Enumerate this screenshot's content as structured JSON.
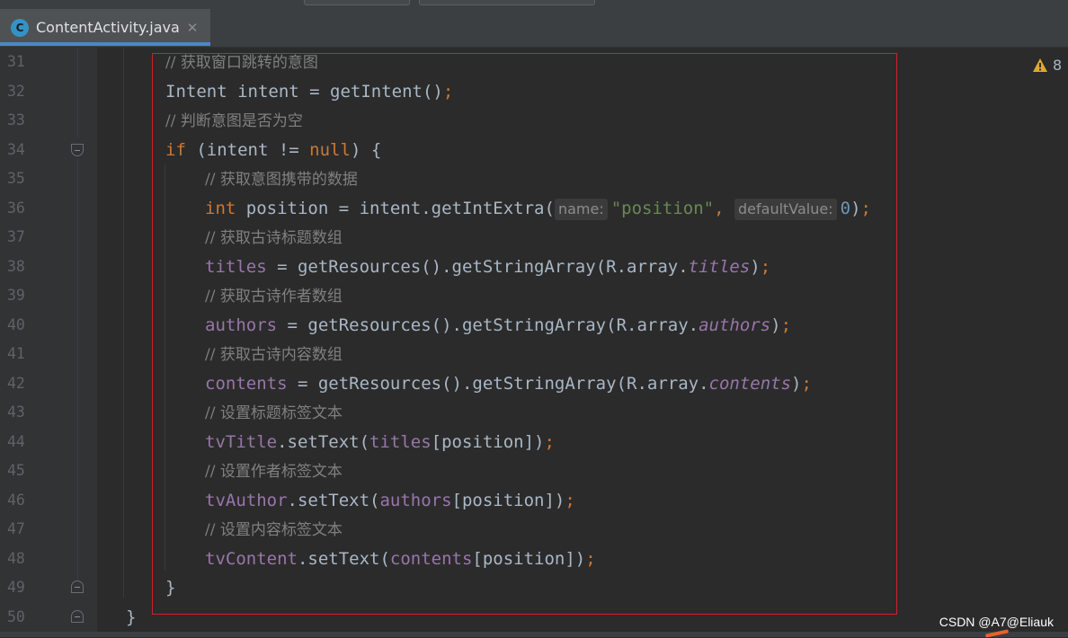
{
  "tab": {
    "icon_letter": "C",
    "title": "ContentActivity.java",
    "close_glyph": "✕"
  },
  "inspections": {
    "warning_count": "8"
  },
  "line_numbers": [
    "31",
    "32",
    "33",
    "34",
    "35",
    "36",
    "37",
    "38",
    "39",
    "40",
    "41",
    "42",
    "43",
    "44",
    "45",
    "46",
    "47",
    "48",
    "49",
    "50"
  ],
  "code": {
    "l31": {
      "comment": "// 获取窗口跳转的意图"
    },
    "l32": {
      "type": "Intent",
      "rest": " intent = getIntent()",
      "semi": ";"
    },
    "l33": {
      "comment": "// 判断意图是否为空"
    },
    "l34": {
      "kw": "if",
      "a": " (intent != ",
      "null": "null",
      "b": ") {"
    },
    "l35": {
      "comment": "// 获取意图携带的数据"
    },
    "l36": {
      "kw": "int",
      "a": " position = intent.getIntExtra(",
      "hint1": "name:",
      "str": "\"position\"",
      "comma": ",",
      "hint2": "defaultValue:",
      "num": "0",
      "close": ")",
      "semi": ";"
    },
    "l37": {
      "comment": "// 获取古诗标题数组"
    },
    "l38": {
      "fld": "titles",
      "a": " = getResources().getStringArray(R.array.",
      "st": "titles",
      "close": ")",
      "semi": ";"
    },
    "l39": {
      "comment": "// 获取古诗作者数组"
    },
    "l40": {
      "fld": "authors",
      "a": " = getResources().getStringArray(R.array.",
      "st": "authors",
      "close": ")",
      "semi": ";"
    },
    "l41": {
      "comment": "// 获取古诗内容数组"
    },
    "l42": {
      "fld": "contents",
      "a": " = getResources().getStringArray(R.array.",
      "st": "contents",
      "close": ")",
      "semi": ";"
    },
    "l43": {
      "comment": "// 设置标题标签文本"
    },
    "l44": {
      "fld": "tvTitle",
      "a": ".setText(",
      "fld2": "titles",
      "b": "[position])",
      "semi": ";"
    },
    "l45": {
      "comment": "// 设置作者标签文本"
    },
    "l46": {
      "fld": "tvAuthor",
      "a": ".setText(",
      "fld2": "authors",
      "b": "[position])",
      "semi": ";"
    },
    "l47": {
      "comment": "// 设置内容标签文本"
    },
    "l48": {
      "fld": "tvContent",
      "a": ".setText(",
      "fld2": "contents",
      "b": "[position])",
      "semi": ";"
    },
    "l49": {
      "a": "}"
    },
    "l50": {
      "a": "}"
    }
  },
  "watermark": "CSDN @A7@Eliauk",
  "colors": {
    "background": "#2b2b2b",
    "keyword": "#cc7832",
    "field": "#9876aa",
    "string": "#6a8759",
    "number": "#6897bb",
    "comment": "#808080",
    "highlight_box": "#d0212a",
    "tab_accent": "#4a88c7"
  }
}
